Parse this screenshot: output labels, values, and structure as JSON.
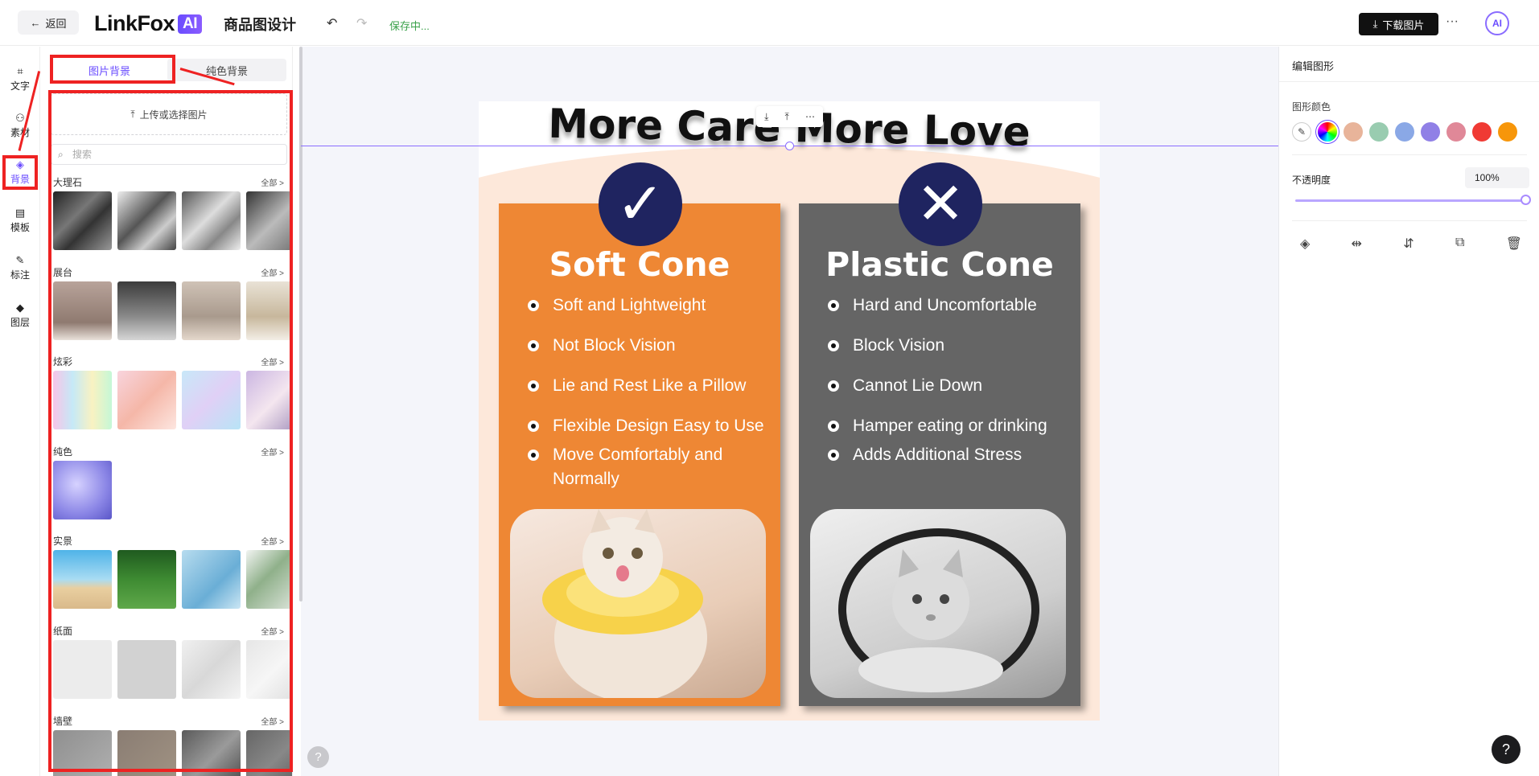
{
  "header": {
    "back_label": "返回",
    "logo_text": "LinkFox",
    "logo_badge": "AI",
    "page_title": "商品图设计",
    "save_status": "保存中...",
    "download_label": "下载图片",
    "more": "···",
    "avatar": "AI"
  },
  "rail": {
    "items": [
      {
        "label": "文字"
      },
      {
        "label": "素材"
      },
      {
        "label": "背景"
      },
      {
        "label": "模板"
      },
      {
        "label": "标注"
      },
      {
        "label": "图层"
      }
    ]
  },
  "panel": {
    "tabs": [
      "图片背景",
      "纯色背景"
    ],
    "upload_label": "上传或选择图片",
    "search_placeholder": "搜索",
    "all_label": "全部 >",
    "categories": [
      {
        "name": "大理石"
      },
      {
        "name": "展台"
      },
      {
        "name": "炫彩"
      },
      {
        "name": "纯色"
      },
      {
        "name": "实景"
      },
      {
        "name": "纸面"
      },
      {
        "name": "墙壁"
      }
    ]
  },
  "poster": {
    "title": "More Care More Love",
    "left": {
      "title": "Soft Cone",
      "badge": "✓",
      "items": [
        "Soft and Lightweight",
        "Not Block Vision",
        "Lie and Rest Like a Pillow",
        "Flexible Design Easy to Use",
        "Move Comfortably and Normally"
      ]
    },
    "right": {
      "title": "Plastic Cone",
      "badge": "✕",
      "items": [
        "Hard and Uncomfortable",
        "Block Vision",
        "Cannot Lie Down",
        "Hamper eating or drinking",
        "Adds Additional Stress"
      ]
    }
  },
  "right_panel": {
    "title": "编辑图形",
    "color_label": "图形颜色",
    "swatches": [
      "#e8b49a",
      "#99ccb0",
      "#8aa8e6",
      "#9080e6",
      "#e08898",
      "#f03a34",
      "#f7960a"
    ],
    "opacity_label": "不透明度",
    "opacity_value": "100%"
  },
  "help": "?"
}
